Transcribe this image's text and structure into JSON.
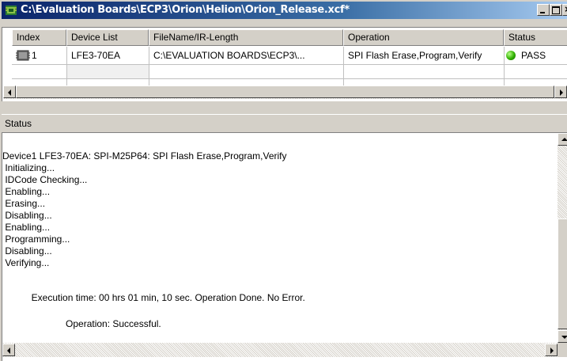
{
  "window": {
    "title": "C:\\Evaluation Boards\\ECP3\\Orion\\Helion\\Orion_Release.xcf*",
    "close_glyph": "×"
  },
  "device_table": {
    "columns": [
      "Index",
      "Device List",
      "FileName/IR-Length",
      "Operation",
      "Status"
    ],
    "rows": [
      {
        "index": "1",
        "device": "LFE3-70EA",
        "file": "C:\\EVALUATION BOARDS\\ECP3\\...",
        "operation": "SPI Flash Erase,Program,Verify",
        "status": "PASS",
        "status_color": "#2fb000",
        "icon": "chip-icon"
      }
    ]
  },
  "status_pane": {
    "title": "Status",
    "log": [
      "Device1 LFE3-70EA: SPI-M25P64: SPI Flash Erase,Program,Verify",
      " Initializing...",
      " IDCode Checking...",
      " Enabling...",
      " Erasing...",
      " Disabling...",
      " Enabling...",
      " Programming...",
      " Disabling...",
      " Verifying...",
      "",
      "           Execution time: 00 hrs 01 min, 10 sec. Operation Done. No Error.",
      "",
      "                        Operation: Successful."
    ]
  }
}
